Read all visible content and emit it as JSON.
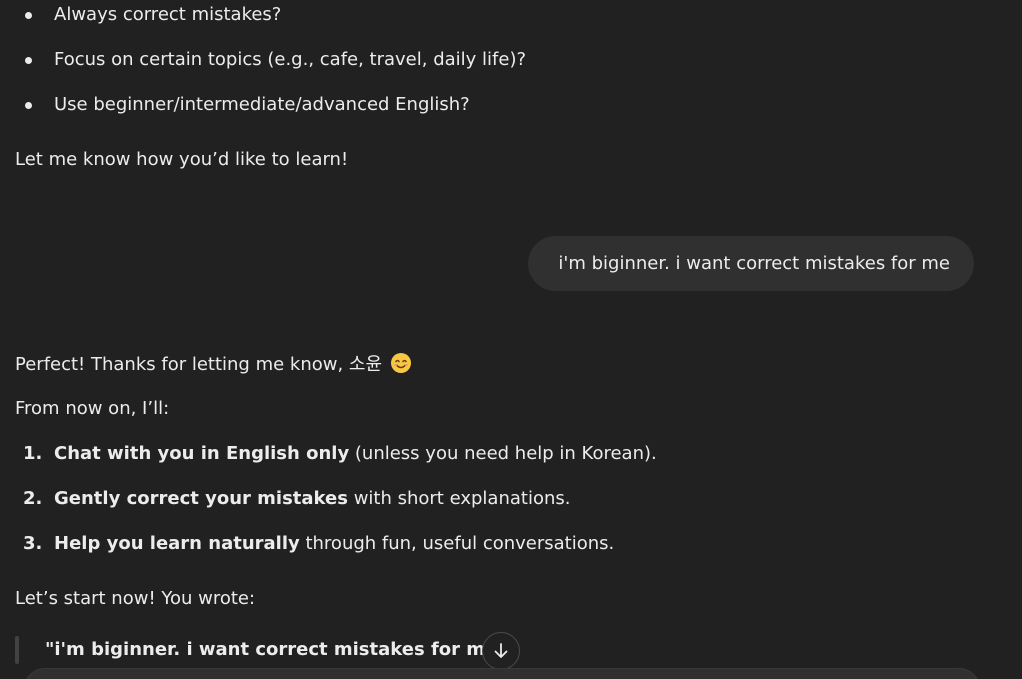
{
  "top_list": [
    "Always correct mistakes?",
    "Focus on certain topics (e.g., cafe, travel, daily life)?",
    "Use beginner/intermediate/advanced English?"
  ],
  "let_me_know": "Let me know how you’d like to learn!",
  "user_message": "i'm biginner. i want correct mistakes for me",
  "assistant": {
    "perfect_line": "Perfect! Thanks for letting me know, 소윤",
    "emoji": "smiling-face-emoji",
    "from_now_on": "From now on, I’ll:",
    "steps": [
      {
        "num": "1.",
        "bold": "Chat with you in English only",
        "rest": " (unless you need help in Korean)."
      },
      {
        "num": "2.",
        "bold": "Gently correct your mistakes",
        "rest": " with short explanations."
      },
      {
        "num": "3.",
        "bold": "Help you learn naturally",
        "rest": " through fun, useful conversations."
      }
    ],
    "lets_start": "Let’s start now! You wrote:",
    "quote": "\"i'm biginner. i want correct mistakes for me\""
  },
  "scroll_button_icon": "arrow-down-icon",
  "colors": {
    "background": "#212121",
    "text": "#ececec",
    "user_bubble": "#303030"
  }
}
